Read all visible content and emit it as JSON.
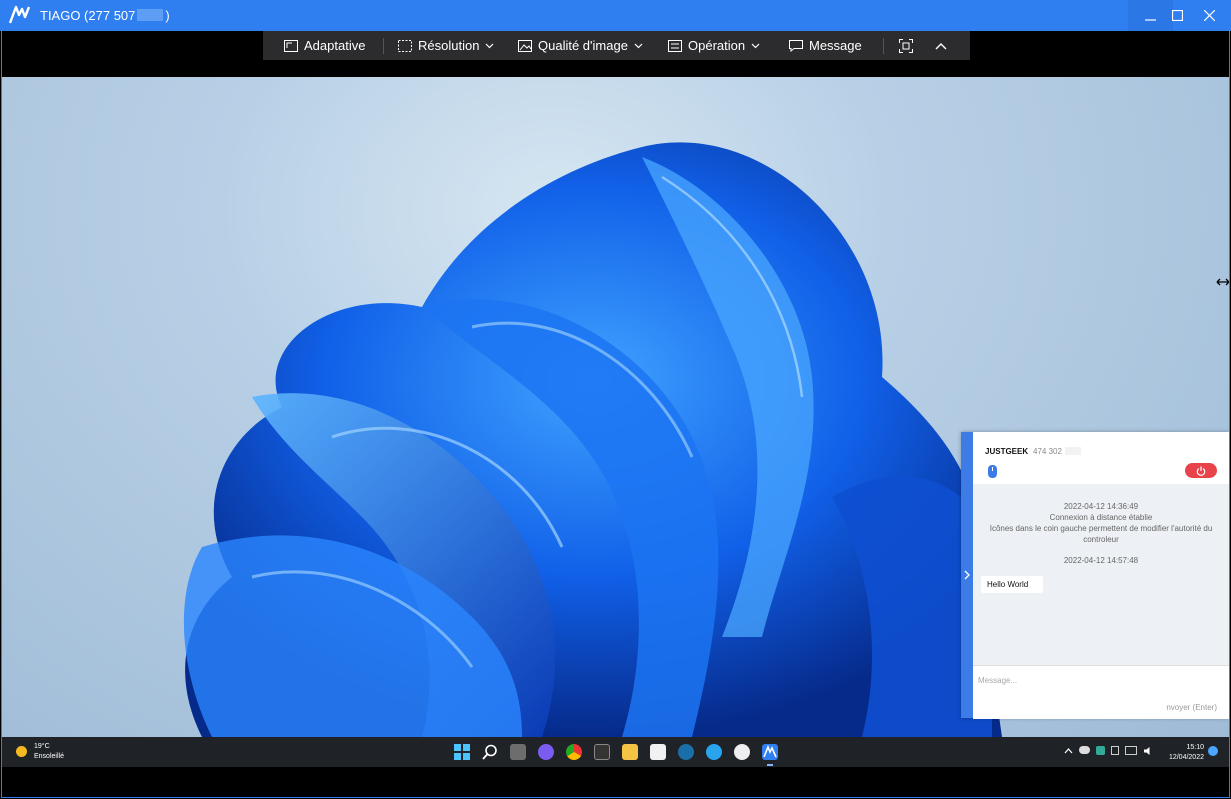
{
  "window": {
    "title_prefix": "TIAGO (277 507",
    "title_suffix": ")"
  },
  "toolbar": {
    "adaptive": "Adaptative",
    "resolution": "Résolution",
    "quality": "Qualité d'image",
    "operation": "Opération",
    "message": "Message"
  },
  "chat": {
    "user": "JUSTGEEK",
    "user_id": "474 302",
    "messages": [
      {
        "time": "2022-04-12 14:36:49",
        "lines": [
          "Connexion à distance établie",
          "Icônes dans le coin gauche permettent de modifier l'autorité du",
          "controleur"
        ]
      },
      {
        "time": "2022-04-12 14:57:48",
        "bubble": "Hello World"
      }
    ],
    "placeholder": "Message...",
    "send": "nvoyer (Enter)"
  },
  "taskbar": {
    "weather_temp": "19°C",
    "weather_desc": "Ensoleillé",
    "time": "15:10",
    "date": "12/04/2022"
  },
  "colors": {
    "titlebar": "#2f7ff0",
    "accent": "#3d7ce6",
    "disconnect": "#e8434a"
  }
}
